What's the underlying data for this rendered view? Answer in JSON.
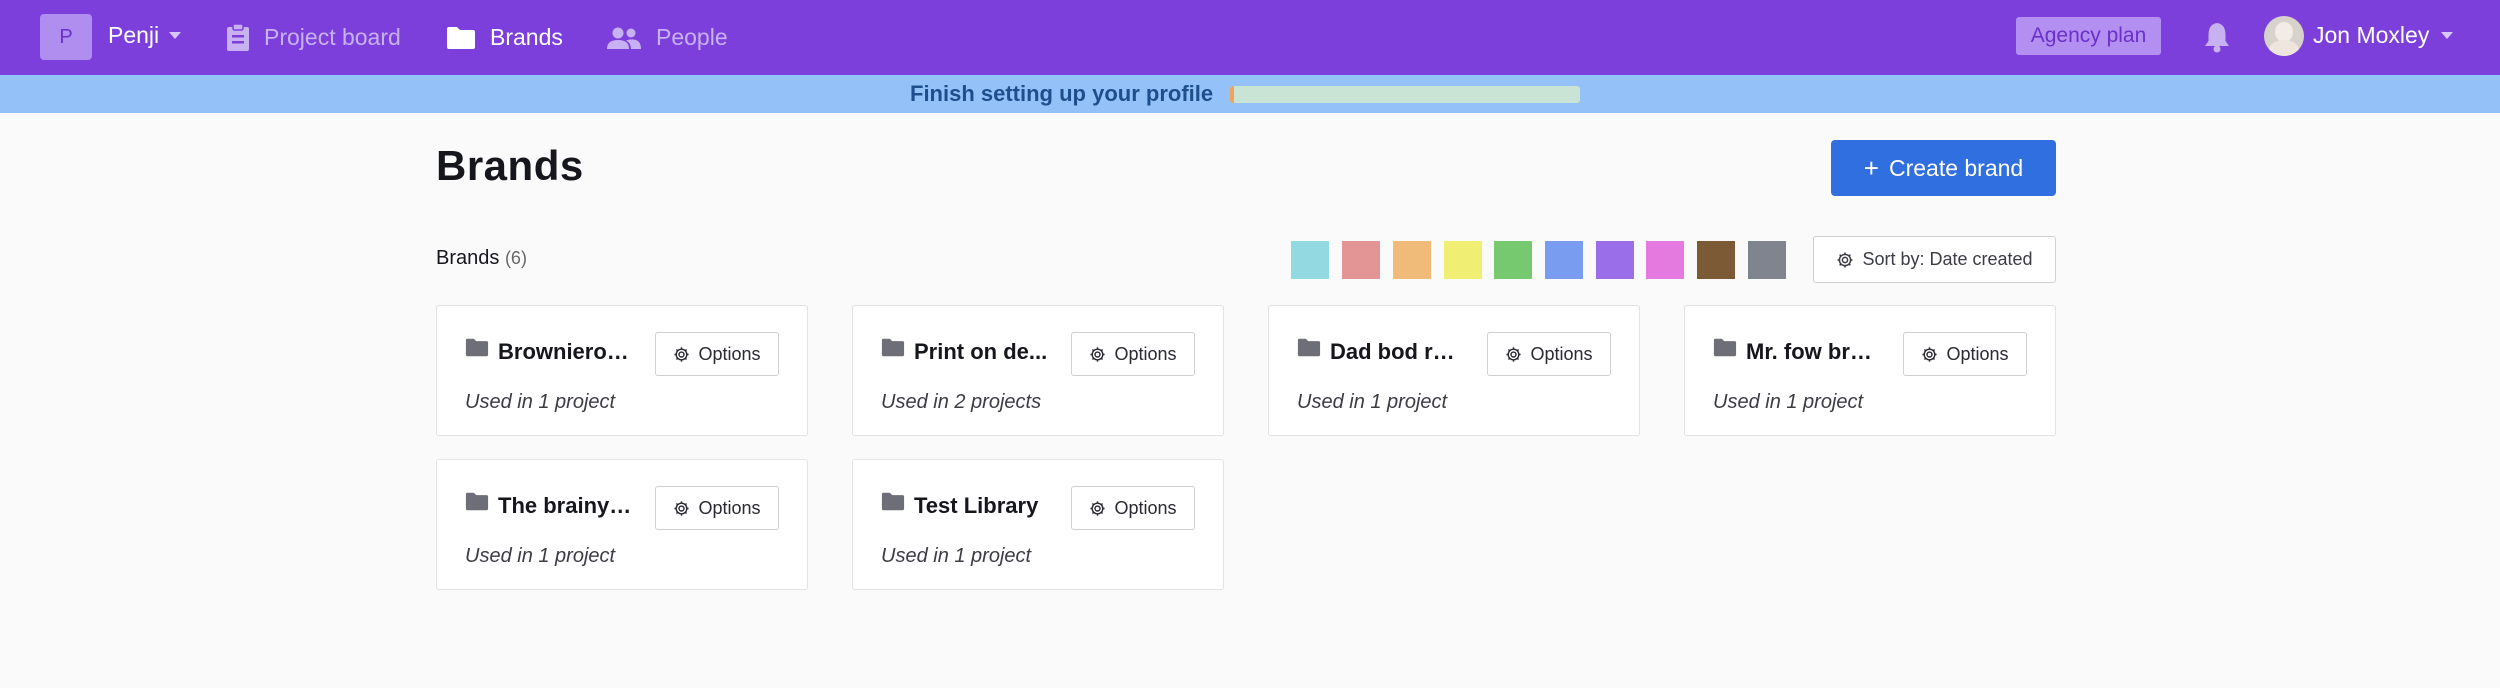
{
  "nav": {
    "workspace_initial": "P",
    "workspace_name": "Penji",
    "items": [
      {
        "label": "Project board",
        "icon": "clipboard-icon",
        "active": false
      },
      {
        "label": "Brands",
        "icon": "folder-icon",
        "active": true
      },
      {
        "label": "People",
        "icon": "people-icon",
        "active": false
      }
    ],
    "plan_badge": "Agency plan",
    "user_name": "Jon Moxley"
  },
  "banner": {
    "text": "Finish setting up your profile",
    "progress_fraction": 0.01
  },
  "page": {
    "title": "Brands",
    "create_button": "Create brand",
    "list_label": "Brands",
    "list_count": "(6)",
    "sort_label": "Sort by: Date created"
  },
  "colors": {
    "nav_background": "#7d3fdb",
    "banner_background": "#94c1f8",
    "primary_button": "#2f6fe0",
    "swatches": [
      "#93d9e2",
      "#e39595",
      "#f0bb79",
      "#f1ef73",
      "#76c96f",
      "#7a9cf0",
      "#9a6ee8",
      "#e47ae0",
      "#7d5a36",
      "#80848f"
    ]
  },
  "brands": [
    {
      "name": "Brownierou...",
      "usage": "Used in 1 project",
      "options": "Options"
    },
    {
      "name": "Print on de...",
      "usage": "Used in 2 projects",
      "options": "Options"
    },
    {
      "name": "Dad bod run...",
      "usage": "Used in 1 project",
      "options": "Options"
    },
    {
      "name": "Mr. fow bran...",
      "usage": "Used in 1 project",
      "options": "Options"
    },
    {
      "name": "The brainy b...",
      "usage": "Used in 1 project",
      "options": "Options"
    },
    {
      "name": "Test Library",
      "usage": "Used in 1 project",
      "options": "Options"
    }
  ]
}
